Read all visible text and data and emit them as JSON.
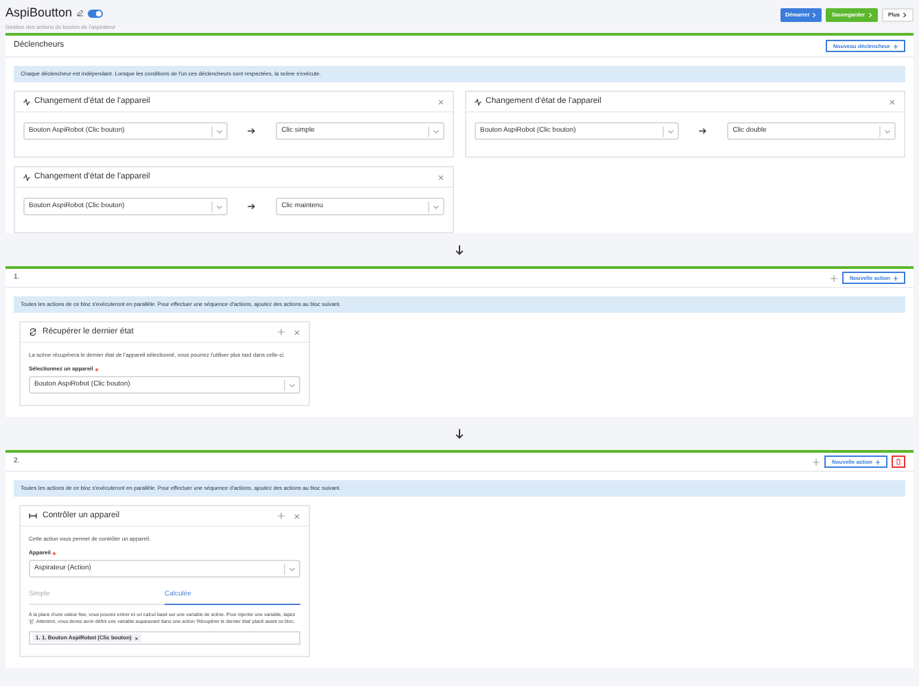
{
  "header": {
    "title": "AspiBoutton",
    "enabled": true,
    "subtitle": "Gestion des actions du bouton de l'aspirateur",
    "buttons": [
      {
        "label": "Démarrer",
        "kind": "start"
      },
      {
        "label": "Sauvegarder",
        "kind": "save"
      },
      {
        "label": "Plus",
        "kind": "more"
      }
    ]
  },
  "triggers": {
    "title": "Déclencheurs",
    "new_button": "Nouveau déclencheur",
    "info": "Chaque déclencheur est indépendant. Lorsque les conditions de l'un ces déclencheurs sont respectées, la scène s'exécute.",
    "items": [
      {
        "title": "Changement d'état de l'appareil",
        "device": "Bouton AspiRobot (Clic bouton)",
        "value": "Clic simple"
      },
      {
        "title": "Changement d'état de l'appareil",
        "device": "Bouton AspiRobot (Clic bouton)",
        "value": "Clic double"
      },
      {
        "title": "Changement d'état de l'appareil",
        "device": "Bouton AspiRobot (Clic bouton)",
        "value": "Clic maintenu"
      }
    ]
  },
  "blocks": [
    {
      "title": "1.",
      "new_button": "Nouvelle action",
      "deletable": false,
      "info": "Toutes les actions de ce bloc s'exécuteront en parallèle. Pour effectuer une séquence d'actions, ajoutez des actions au bloc suivant.",
      "action": {
        "kind": "fetch",
        "title": "Récupérer le dernier état",
        "description": "La scène récupérera le dernier état de l'appareil sélectionné, vous pourrez l'utiliser plus tard dans celle-ci.",
        "field_label": "Sélectionnez un appareil",
        "field_value": "Bouton AspiRobot (Clic bouton)"
      }
    },
    {
      "title": "2.",
      "new_button": "Nouvelle action",
      "deletable": true,
      "info": "Toutes les actions de ce bloc s'exécuteront en parallèle. Pour effectuer une séquence d'actions, ajoutez des actions au bloc suivant.",
      "action": {
        "kind": "control",
        "title": "Contrôler un appareil",
        "description": "Cette action vous permet de contrôler un appareil.",
        "field_label": "Appareil",
        "field_value": "Aspirateur (Action)",
        "tabs": [
          {
            "label": "Simple",
            "selected": false
          },
          {
            "label": "Calculée",
            "selected": true
          }
        ],
        "help": "À la place d'une valeur fixe, vous pouvez entrer ici un calcul basé sur une variable de scène. Pour injecter une variable, tapez '{{'. Attention, vous devez avoir défini une variable auparavant dans une action 'Récupérer le dernier état' placé avant ce bloc.",
        "tag": "1. 1. Bouton AspiRobot (Clic bouton)"
      }
    }
  ]
}
